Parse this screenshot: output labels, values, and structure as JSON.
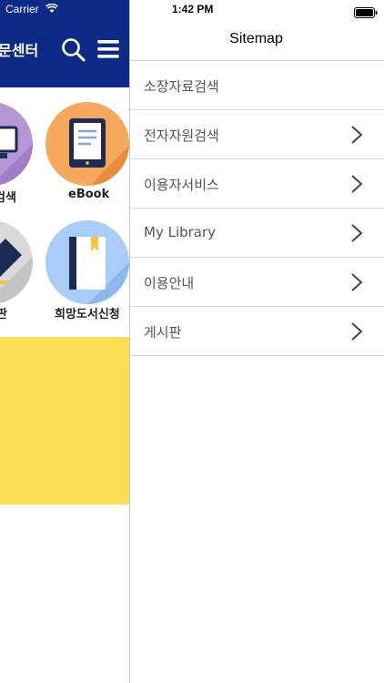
{
  "status_bar": {
    "carrier": "Carrier",
    "time": "1:42 PM"
  },
  "app": {
    "header_title": "문센터",
    "brand_color": "#0d2a86",
    "menu_items": [
      {
        "label": "검색",
        "icon": "monitor-icon"
      },
      {
        "label": "eBook",
        "icon": "ebook-reader-icon"
      },
      {
        "label": "판",
        "icon": "pen-icon"
      },
      {
        "label": "희망도서신청",
        "icon": "book-bookmark-icon"
      }
    ],
    "banner_color": "#fcde55"
  },
  "sitemap": {
    "title": "Sitemap",
    "items": [
      {
        "label": "소장자료검색",
        "has_chevron": false
      },
      {
        "label": "전자자원검색",
        "has_chevron": true
      },
      {
        "label": "이용자서비스",
        "has_chevron": true
      },
      {
        "label": "My Library",
        "has_chevron": true
      },
      {
        "label": "이용안내",
        "has_chevron": true
      },
      {
        "label": "게시판",
        "has_chevron": true
      }
    ]
  }
}
